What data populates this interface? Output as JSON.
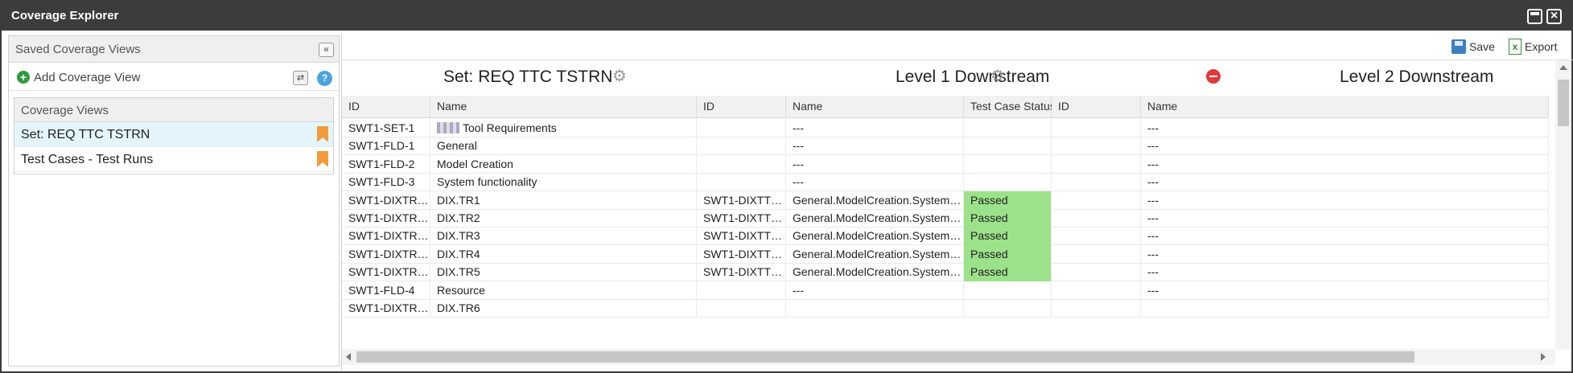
{
  "window": {
    "title": "Coverage Explorer"
  },
  "sidebar": {
    "header": "Saved Coverage Views",
    "add_label": "Add Coverage View",
    "views_header": "Coverage Views",
    "views": [
      {
        "label": "Set: REQ TTC TSTRN"
      },
      {
        "label": "Test Cases - Test Runs"
      }
    ]
  },
  "toolbar": {
    "save_label": "Save",
    "export_label": "Export"
  },
  "sections": {
    "set": "Set: REQ TTC TSTRN",
    "level1": "Level 1 Downstream",
    "level2": "Level 2 Downstream"
  },
  "columns": [
    "ID",
    "Name",
    "ID",
    "Name",
    "Test Case Status",
    "ID",
    "Name"
  ],
  "rows": [
    [
      "SWT1-SET-1",
      "Tool Requirements",
      "",
      "---",
      "",
      "",
      "---"
    ],
    [
      "SWT1-FLD-1",
      "General",
      "",
      "---",
      "",
      "",
      "---"
    ],
    [
      "SWT1-FLD-2",
      "Model Creation",
      "",
      "---",
      "",
      "",
      "---"
    ],
    [
      "SWT1-FLD-3",
      "System functionality",
      "",
      "---",
      "",
      "",
      "---"
    ],
    [
      "SWT1-DIXTRE...",
      "DIX.TR1",
      "SWT1-DIXTTC-1",
      "General.ModelCreation.SystemFunc...",
      "Passed",
      "",
      "---"
    ],
    [
      "SWT1-DIXTRE...",
      "DIX.TR2",
      "SWT1-DIXTTC-1",
      "General.ModelCreation.SystemFunc...",
      "Passed",
      "",
      "---"
    ],
    [
      "SWT1-DIXTRE...",
      "DIX.TR3",
      "SWT1-DIXTTC-1",
      "General.ModelCreation.SystemFunc...",
      "Passed",
      "",
      "---"
    ],
    [
      "SWT1-DIXTRE...",
      "DIX.TR4",
      "SWT1-DIXTTC-1",
      "General.ModelCreation.SystemFunc...",
      "Passed",
      "",
      "---"
    ],
    [
      "SWT1-DIXTRE...",
      "DIX.TR5",
      "SWT1-DIXTTC-1",
      "General.ModelCreation.SystemFunc...",
      "Passed",
      "",
      "---"
    ],
    [
      "SWT1-FLD-4",
      "Resource",
      "",
      "---",
      "",
      "",
      "---"
    ],
    [
      "SWT1-DIXTRE...",
      "DIX.TR6",
      "",
      "",
      "",
      "",
      ""
    ]
  ],
  "colors": {
    "passed": "#9ce28b",
    "selected": "#e3f5fb",
    "titlebar": "#3c3c3c"
  }
}
